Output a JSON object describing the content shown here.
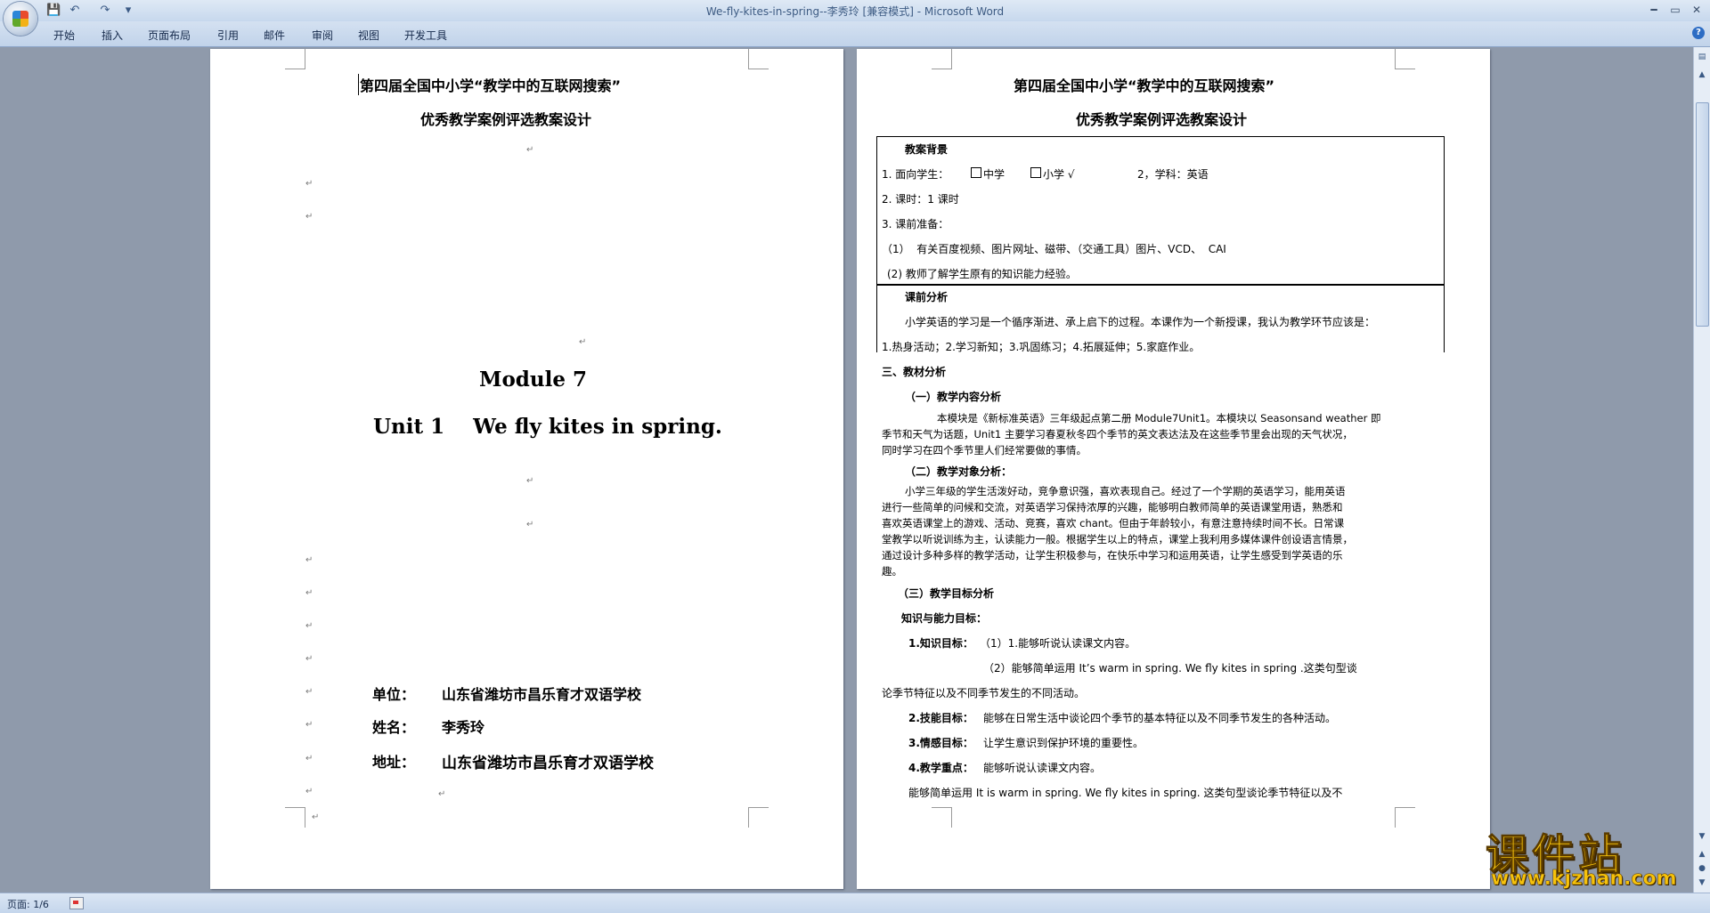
{
  "window": {
    "title": "We-fly-kites-in-spring--李秀玲 [兼容模式] - ",
    "app_name": "Microsoft Word",
    "controls": {
      "minimize": "━",
      "maximize": "▭",
      "close": "✕"
    }
  },
  "quick_access": {
    "save": "💾",
    "undo": "↶",
    "redo": "↷",
    "customize": "▾"
  },
  "ribbon": {
    "tabs": [
      "开始",
      "插入",
      "页面布局",
      "引用",
      "邮件",
      "审阅",
      "视图",
      "开发工具"
    ],
    "help": "?"
  },
  "marks": {
    "para": "↵"
  },
  "page1": {
    "header_line1": "第四届全国中小学“教学中的互联网搜索”",
    "header_line2": "优秀教学案例评选教案设计",
    "module": "Module 7",
    "unit": "Unit 1    We fly kites in spring.",
    "unit_label": "单位：",
    "unit_value": "山东省潍坊市昌乐育才双语学校",
    "name_label": "姓名：",
    "name_value": "李秀玲",
    "addr_label": "地址：",
    "addr_value": "山东省潍坊市昌乐育才双语学校"
  },
  "page2": {
    "header_line1": "第四届全国中小学“教学中的互联网搜索”",
    "header_line2": "优秀教学案例评选教案设计",
    "s1_title": "教案背景",
    "s1_l1a": "1. 面向学生：",
    "s1_l1b": "中学",
    "s1_l1c": "小学 √",
    "s1_l1d": "2，学科：英语",
    "s1_l2": "2. 课时：1 课时",
    "s1_l3": "3. 课前准备：",
    "s1_l4": "（1）  有关百度视频、图片网址、磁带、（交通工具）图片、VCD、  CAI",
    "s1_l5": "(2) 教师了解学生原有的知识能力经验。",
    "s2_title": "课前分析",
    "s2_l1": "小学英语的学习是一个循序渐进、承上启下的过程。本课作为一个新授课，我认为教学环节应该是：",
    "s2_l2": "1.热身活动；2.学习新知；3.巩固练习；4.拓展延伸；5.家庭作业。",
    "s3_title": "三、教材分析",
    "s3_1_title": "（一）教学内容分析",
    "s3_1_p1": "本模块是《新标准英语》三年级起点第二册 Module7Unit1。本模块以 Seasonsand  weather 即",
    "s3_1_p2": "季节和天气为话题，Unit1 主要学习春夏秋冬四个季节的英文表达法及在这些季节里会出现的天气状况，",
    "s3_1_p3": "同时学习在四个季节里人们经常要做的事情。",
    "s3_2_title": "（二）教学对象分析：",
    "s3_2_p1": "小学三年级的学生活泼好动，竞争意识强，喜欢表现自己。经过了一个学期的英语学习，能用英语",
    "s3_2_p2": "进行一些简单的问候和交流，对英语学习保持浓厚的兴趣，能够明白教师简单的英语课堂用语，熟悉和",
    "s3_2_p3": "喜欢英语课堂上的游戏、活动、竞赛，喜欢 chant。但由于年龄较小，有意注意持续时间不长。日常课",
    "s3_2_p4": "堂教学以听说训练为主，认读能力一般。根据学生以上的特点，课堂上我利用多媒体课件创设语言情景，",
    "s3_2_p5": "通过设计多种多样的教学活动，让学生积极参与，在快乐中学习和运用英语，让学生感受到学英语的乐",
    "s3_2_p6": "趣。",
    "s3_3_title": "（三）教学目标分析",
    "goal_title": "知识与能力目标：",
    "g1_label": "1.知识目标：",
    "g1_text": "（1）1.能够听说认读课文内容。",
    "g1_text2": "（2）能够简单运用 It’s warm in spring. We fly kites in spring .这类句型谈",
    "g1_text3": "论季节特征以及不同季节发生的不同活动。",
    "g2_label": "2.技能目标：",
    "g2_text": "能够在日常生活中谈论四个季节的基本特征以及不同季节发生的各种活动。",
    "g3_label": "3.情感目标：",
    "g3_text": "让学生意识到保护环境的重要性。",
    "g4_label": "4.教学重点：",
    "g4_text": "能够听说认读课文内容。",
    "g4_text2": "能够简单运用 It is warm in spring. We fly kites in spring. 这类句型谈论季节特征以及不"
  },
  "status": {
    "page_indicator": "页面: 1/6"
  },
  "watermark": {
    "title": "课件站",
    "url": "www.kjzhan.com"
  }
}
